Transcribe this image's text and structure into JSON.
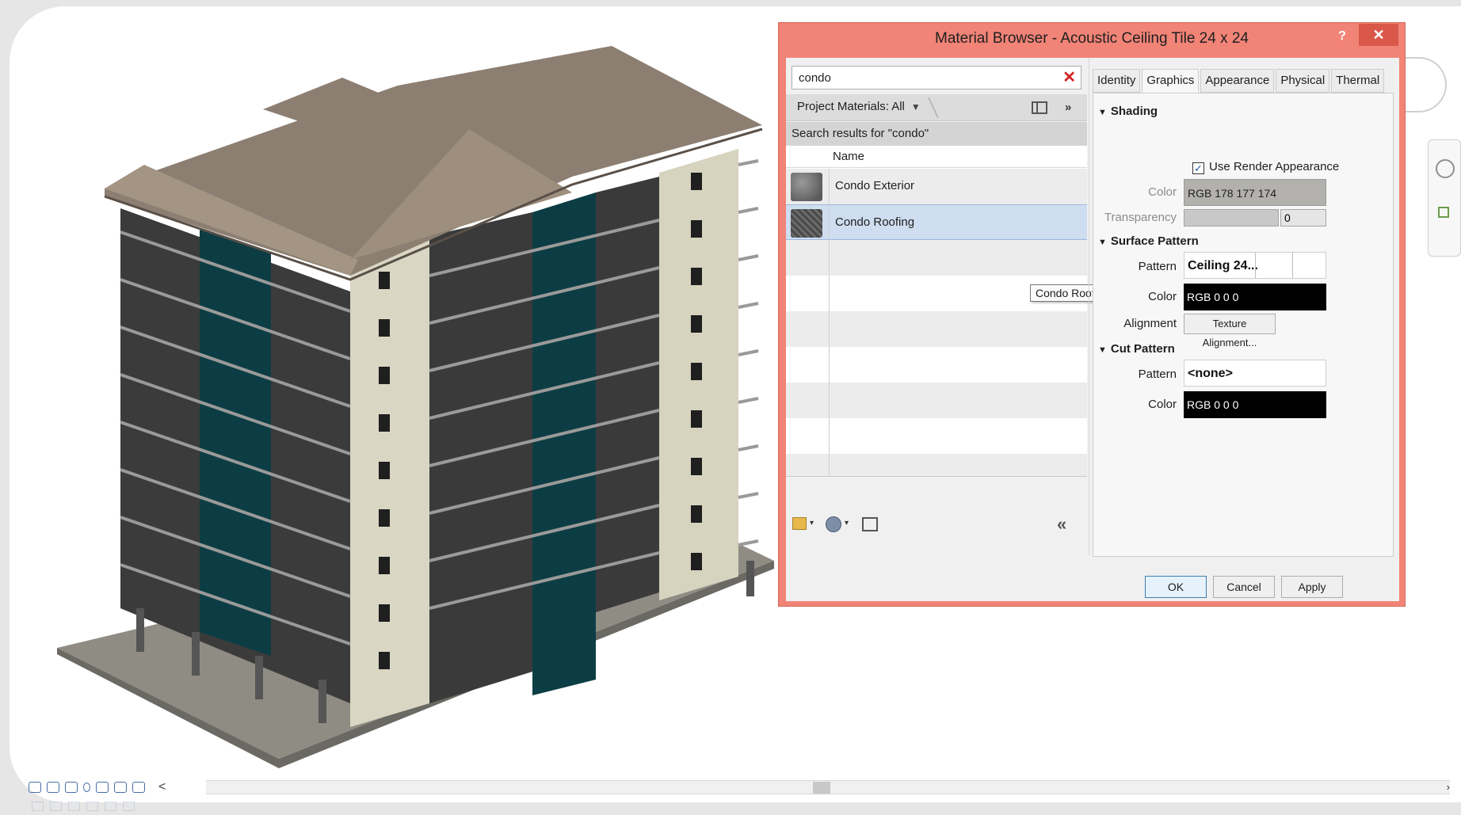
{
  "dialog": {
    "title": "Material Browser - Acoustic Ceiling Tile 24 x 24",
    "help_label": "?",
    "close_label": "✕"
  },
  "search": {
    "value": "condo",
    "clear_label": "✕"
  },
  "filter": {
    "label": "Project Materials: All",
    "arrow": "▼",
    "expand": "»"
  },
  "results_header": "Search results for \"condo\"",
  "list": {
    "column_name": "Name",
    "items": [
      {
        "label": "Condo Exterior",
        "thumb_icon": "concrete-thumbnail"
      },
      {
        "label": "Condo Roofing",
        "thumb_icon": "roofing-thumbnail",
        "selected": true
      }
    ]
  },
  "tooltip": "Condo Roofing",
  "left_bar": {
    "add_arrow": "▾",
    "lib_arrow": "▾",
    "collapse": "«"
  },
  "tabs": [
    "Identity",
    "Graphics",
    "Appearance",
    "Physical",
    "Thermal"
  ],
  "active_tab": "Graphics",
  "shading": {
    "heading": "Shading",
    "tri": "▼",
    "use_render_label": "Use Render Appearance",
    "use_render_checked": true,
    "check_mark": "✓",
    "color_label": "Color",
    "color_value": "RGB 178 177 174",
    "transparency_label": "Transparency",
    "transparency_value": "0"
  },
  "surface_pattern": {
    "heading": "Surface Pattern",
    "tri": "▼",
    "pattern_label": "Pattern",
    "pattern_value": "Ceiling 24...",
    "color_label": "Color",
    "color_value": "RGB 0 0 0",
    "alignment_label": "Alignment",
    "alignment_button": "Texture Alignment..."
  },
  "cut_pattern": {
    "heading": "Cut Pattern",
    "tri": "▼",
    "pattern_label": "Pattern",
    "pattern_value": "<none>",
    "color_label": "Color",
    "color_value": "RGB 0 0 0"
  },
  "buttons": {
    "ok": "OK",
    "cancel": "Cancel",
    "apply": "Apply"
  },
  "status_bar": {
    "chevron": "<",
    "scroll_end": "›"
  },
  "colors": {
    "dialog_frame": "#f18477",
    "close_button": "#d9584a",
    "selection": "#cfddf0",
    "shading_color": "#b2b1ae",
    "pattern_color": "#000000"
  }
}
